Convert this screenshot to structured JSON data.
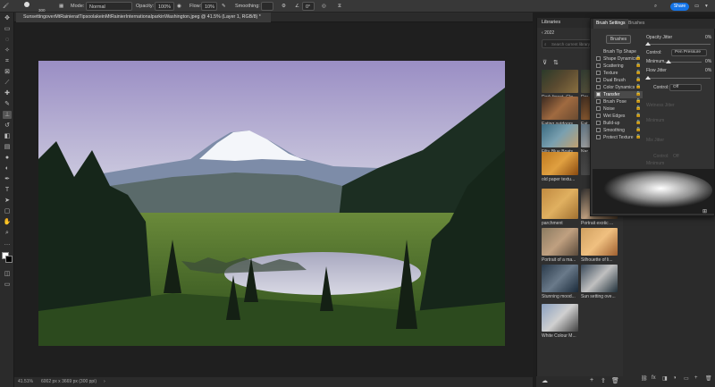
{
  "options_bar": {
    "brush_size": "300",
    "mode_label": "Mode:",
    "mode_value": "Normal",
    "opacity_label": "Opacity:",
    "opacity_value": "100%",
    "flow_label": "Flow:",
    "flow_value": "10%",
    "smoothing_label": "Smoothing:",
    "angle_value": "0°",
    "share_label": "Share"
  },
  "document": {
    "tab_title": "SunsettingoverMtRainieratTipsoolakeinMtRainierInternationalparkinWashington.jpeg @ 41.5% (Layer 1, RGB/8) *"
  },
  "status_bar": {
    "zoom": "41.51%",
    "dimensions": "6002 px x 3669 px (300 ppi)"
  },
  "libraries_panel": {
    "title": "Libraries",
    "library_name": "2022",
    "search_placeholder": "Search current library",
    "items": [
      {
        "label": "Dark forest. Glo...",
        "colors": [
          "#2a3a2a",
          "#5a4a30",
          "#8a7040"
        ]
      },
      {
        "label": "Dar",
        "colors": [
          "#2f3a30",
          "#55503a",
          "#6a5a3a"
        ]
      },
      {
        "label": "Eating outdoors...",
        "colors": [
          "#3a2a20",
          "#a06a40",
          "#6a4a30"
        ]
      },
      {
        "label": "Eat",
        "colors": [
          "#3a2a20",
          "#8a5a30",
          "#5a3a20"
        ]
      },
      {
        "label": "Filtu Blue Boats",
        "colors": [
          "#3a6a80",
          "#7aa0b0",
          "#c0a070"
        ]
      },
      {
        "label": "Nar",
        "colors": [
          "#5a7080",
          "#a0a0a0",
          "#606060"
        ]
      },
      {
        "label": "old paper textu...",
        "colors": [
          "#c07a20",
          "#e0a040",
          "#8a4a10"
        ]
      },
      {
        "label": "",
        "colors": [
          "#3a3a3a",
          "#4a4a4a",
          "#3a3a3a"
        ]
      },
      {
        "label": "parchment",
        "colors": [
          "#c08a40",
          "#e0b060",
          "#a07030"
        ]
      },
      {
        "label": "Portrait exotic ...",
        "colors": [
          "#2a2a2a",
          "#c0a080",
          "#403020"
        ]
      },
      {
        "label": "Portrait of a ma...",
        "colors": [
          "#8a7a60",
          "#c0a080",
          "#5a4a3a"
        ]
      },
      {
        "label": "Silhouette of li...",
        "colors": [
          "#d0a060",
          "#f0c080",
          "#a06030"
        ]
      },
      {
        "label": "Stunning mood...",
        "colors": [
          "#2a3a4a",
          "#6a7a8a",
          "#1a2a3a"
        ]
      },
      {
        "label": "Sun setting ove...",
        "colors": [
          "#3a4a5a",
          "#c0c0c0",
          "#20303a"
        ]
      },
      {
        "label": "White Colour M...",
        "colors": [
          "#8aa0c0",
          "#d0d0d0",
          "#404040"
        ]
      }
    ]
  },
  "brush_settings": {
    "tab_active": "Brush Settings",
    "tab_inactive": "Brushes",
    "brushes_button": "Brushes",
    "options": [
      {
        "label": "Brush Tip Shape",
        "check": false,
        "selected": false
      },
      {
        "label": "Shape Dynamics",
        "check": true,
        "selected": false
      },
      {
        "label": "Scattering",
        "check": true,
        "selected": false
      },
      {
        "label": "Texture",
        "check": true,
        "selected": false
      },
      {
        "label": "Dual Brush",
        "check": true,
        "selected": false
      },
      {
        "label": "Color Dynamics",
        "check": true,
        "selected": false
      },
      {
        "label": "Transfer",
        "check": true,
        "selected": true
      },
      {
        "label": "Brush Pose",
        "check": true,
        "selected": false
      },
      {
        "label": "Noise",
        "check": true,
        "selected": false
      },
      {
        "label": "Wet Edges",
        "check": true,
        "selected": false
      },
      {
        "label": "Build-up",
        "check": true,
        "selected": false
      },
      {
        "label": "Smoothing",
        "check": true,
        "selected": false
      },
      {
        "label": "Protect Texture",
        "check": true,
        "selected": false
      }
    ],
    "opacity_jitter_label": "Opacity Jitter",
    "opacity_jitter_value": "0%",
    "control_label": "Control:",
    "control_value": "Pen Pressure",
    "minimum_label": "Minimum",
    "minimum_value": "0%",
    "flow_jitter_label": "Flow Jitter",
    "flow_jitter_value": "0%",
    "control2_value": "Off",
    "wetness_jitter_label": "Wetness Jitter",
    "minimum2_label": "Minimum",
    "mix_jitter_label": "Mix Jitter",
    "control3_label": "Control:",
    "control3_value": "Off",
    "minimum3_label": "Minimum"
  },
  "colors": {
    "accent": "#1473e6",
    "panel_bg": "#323232",
    "sky_top": "#9a8ec4",
    "sky_bottom": "#e8ecf2"
  }
}
